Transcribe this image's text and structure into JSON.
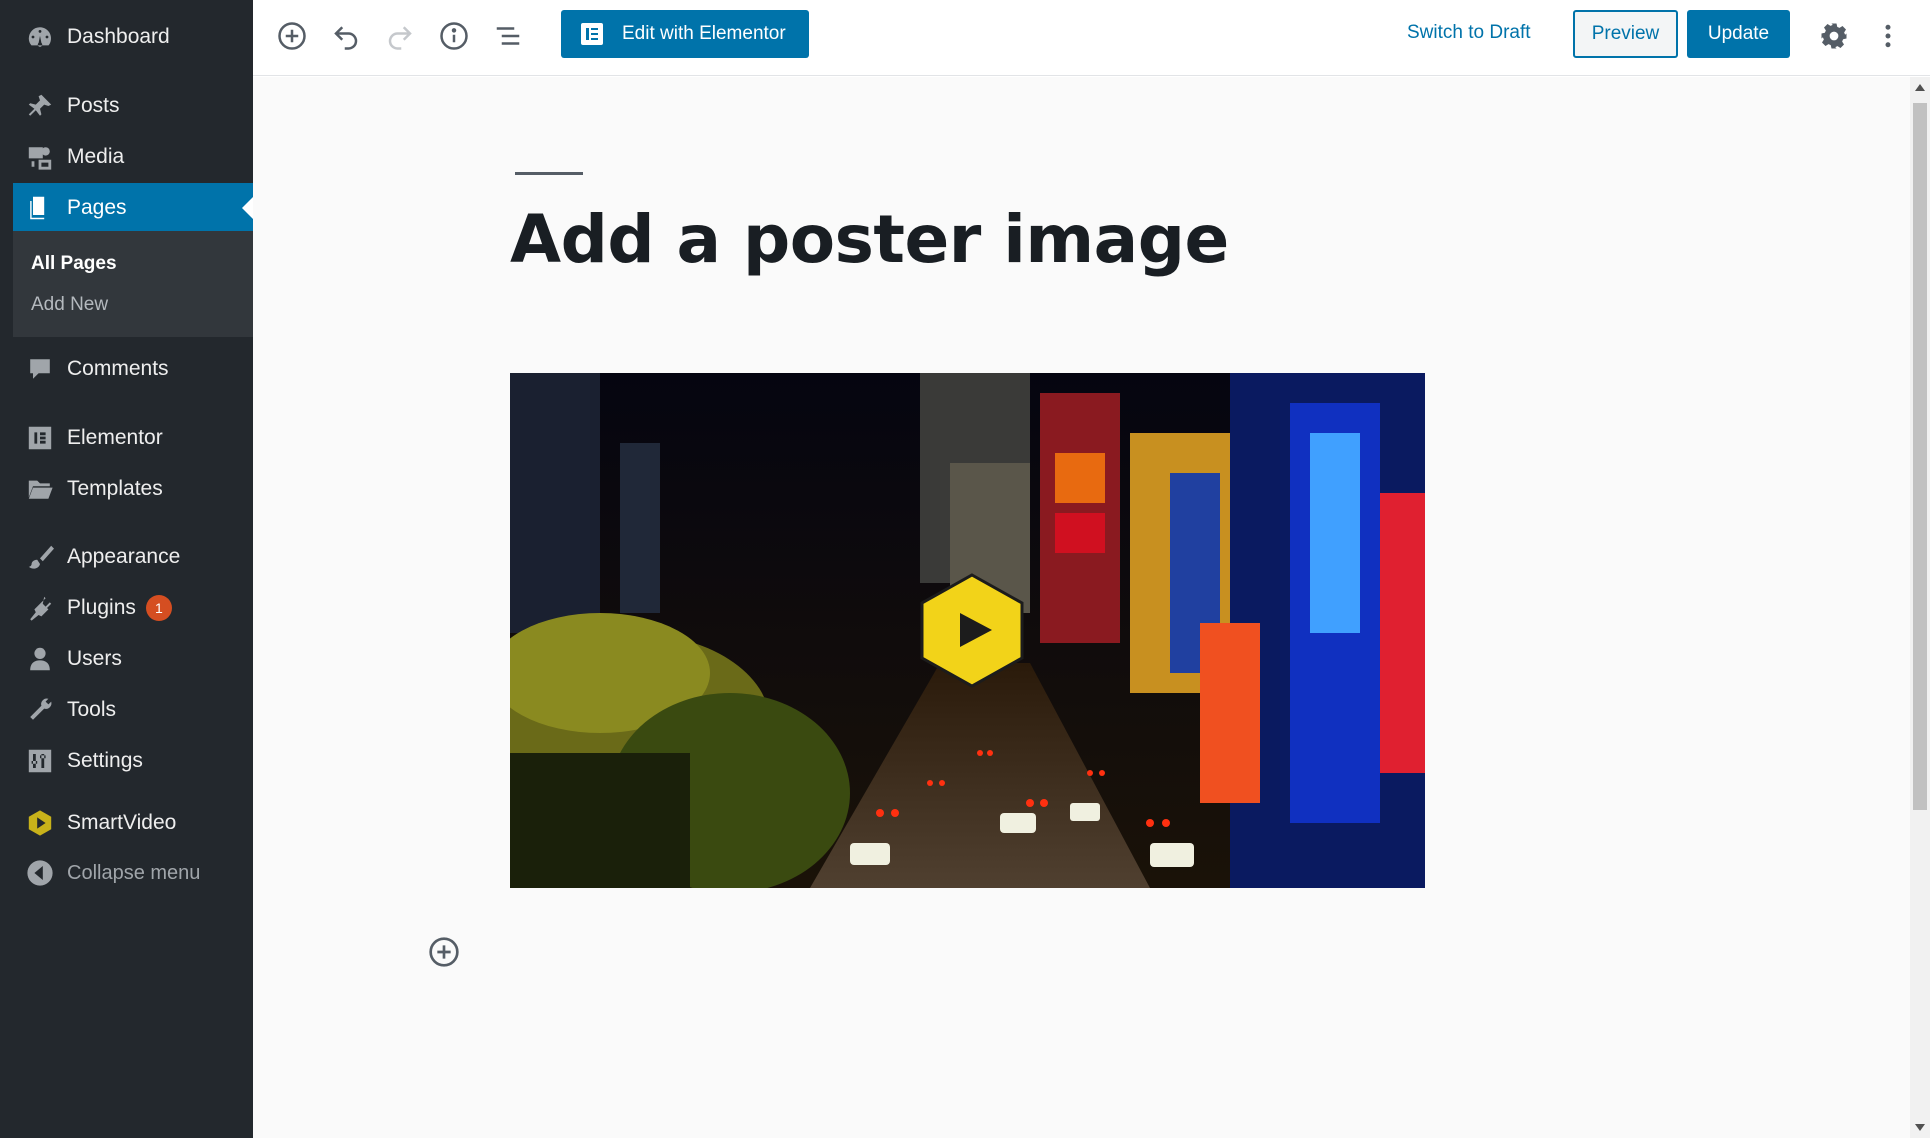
{
  "sidebar": {
    "items": [
      {
        "label": "Dashboard",
        "icon": "dashboard-icon"
      },
      {
        "label": "Posts",
        "icon": "pin-icon"
      },
      {
        "label": "Media",
        "icon": "media-icon"
      },
      {
        "label": "Pages",
        "icon": "pages-icon"
      },
      {
        "label": "Comments",
        "icon": "comment-icon"
      },
      {
        "label": "Elementor",
        "icon": "elementor-icon"
      },
      {
        "label": "Templates",
        "icon": "folder-icon"
      },
      {
        "label": "Appearance",
        "icon": "brush-icon"
      },
      {
        "label": "Plugins",
        "icon": "plug-icon",
        "badge": "1"
      },
      {
        "label": "Users",
        "icon": "user-icon"
      },
      {
        "label": "Tools",
        "icon": "wrench-icon"
      },
      {
        "label": "Settings",
        "icon": "sliders-icon"
      },
      {
        "label": "SmartVideo",
        "icon": "smartvideo-icon"
      },
      {
        "label": "Collapse menu",
        "icon": "collapse-icon"
      }
    ],
    "submenu": [
      "All Pages",
      "Add New"
    ]
  },
  "toolbar": {
    "edit_elementor": "Edit with Elementor",
    "switch_draft": "Switch to Draft",
    "preview": "Preview",
    "update": "Update"
  },
  "editor": {
    "title": "Add a poster image"
  },
  "colors": {
    "accent": "#0073aa",
    "sidebar_bg": "#23282d",
    "play_button": "#f2d319"
  }
}
